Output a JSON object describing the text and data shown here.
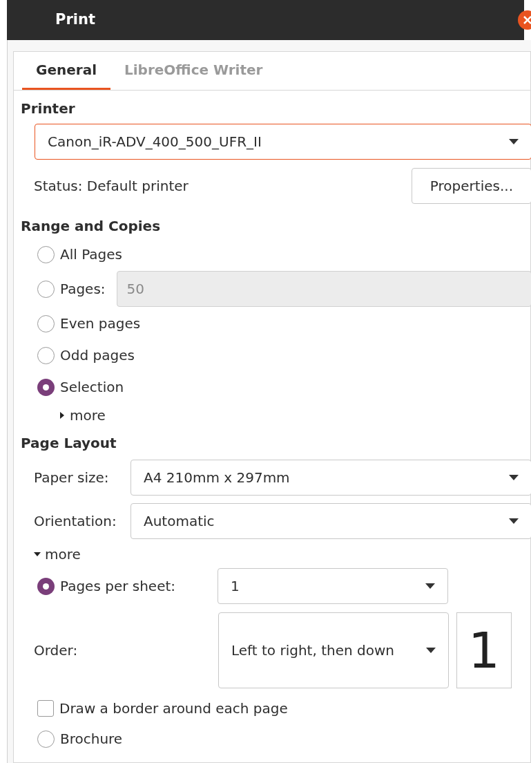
{
  "window": {
    "title": "Print"
  },
  "tabs": [
    {
      "label": "General",
      "selected": true
    },
    {
      "label": "LibreOffice Writer",
      "selected": false
    }
  ],
  "printer": {
    "heading": "Printer",
    "name": "Canon_iR-ADV_400_500_UFR_II",
    "status_label": "Status:",
    "status": "Default printer",
    "properties_button": "Properties..."
  },
  "range": {
    "heading": "Range and Copies",
    "options": [
      {
        "label": "All Pages",
        "selected": false
      },
      {
        "label": "Pages:",
        "selected": false,
        "field": "50"
      },
      {
        "label": "Even pages",
        "selected": false
      },
      {
        "label": "Odd pages",
        "selected": false
      },
      {
        "label": "Selection",
        "selected": true
      }
    ],
    "more": {
      "label": "more",
      "expanded": false
    }
  },
  "layout": {
    "heading": "Page Layout",
    "paper_size": {
      "label": "Paper size:",
      "value": "A4 210mm x 297mm"
    },
    "orientation": {
      "label": "Orientation:",
      "value": "Automatic"
    },
    "more": {
      "label": "more",
      "expanded": true
    },
    "pages_per_sheet": {
      "label": "Pages per sheet:",
      "selected": true,
      "value": "1"
    },
    "order": {
      "label": "Order:",
      "value": "Left to right, then down",
      "preview": "1"
    },
    "border": {
      "label": "Draw a border around each page",
      "checked": false
    },
    "brochure": {
      "label": "Brochure",
      "selected": false
    }
  }
}
